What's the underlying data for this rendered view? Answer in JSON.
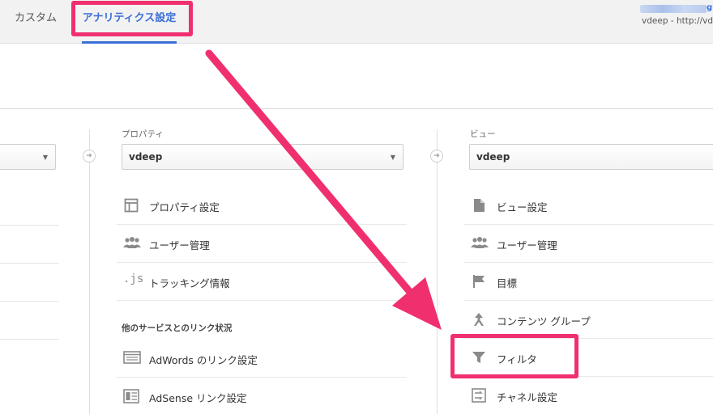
{
  "tabs": {
    "custom": "カスタム",
    "analytics_settings": "アナリティクス設定"
  },
  "account": {
    "name_suffix": "gr",
    "url": "vdeep - http://vd"
  },
  "property_column": {
    "label": "プロパティ",
    "selected": "vdeep",
    "items": [
      {
        "label": "プロパティ設定",
        "icon": "window-icon"
      },
      {
        "label": "ユーザー管理",
        "icon": "users-icon"
      },
      {
        "label": "トラッキング情報",
        "icon": "js-icon"
      }
    ],
    "section_title": "他のサービスとのリンク状況",
    "link_items": [
      {
        "label": "AdWords のリンク設定",
        "icon": "adwords-icon"
      },
      {
        "label": "AdSense リンク設定",
        "icon": "adsense-icon"
      }
    ]
  },
  "view_column": {
    "label": "ビュー",
    "selected": "vdeep",
    "items": [
      {
        "label": "ビュー設定",
        "icon": "document-icon"
      },
      {
        "label": "ユーザー管理",
        "icon": "users-icon"
      },
      {
        "label": "目標",
        "icon": "flag-icon"
      },
      {
        "label": "コンテンツ グループ",
        "icon": "merge-icon"
      },
      {
        "label": "フィルタ",
        "icon": "filter-icon"
      },
      {
        "label": "チャネル設定",
        "icon": "channel-icon"
      }
    ]
  },
  "icons": {
    "js_text": ".js"
  },
  "colors": {
    "accent": "#3a6fd8",
    "highlight": "#f0306e"
  }
}
